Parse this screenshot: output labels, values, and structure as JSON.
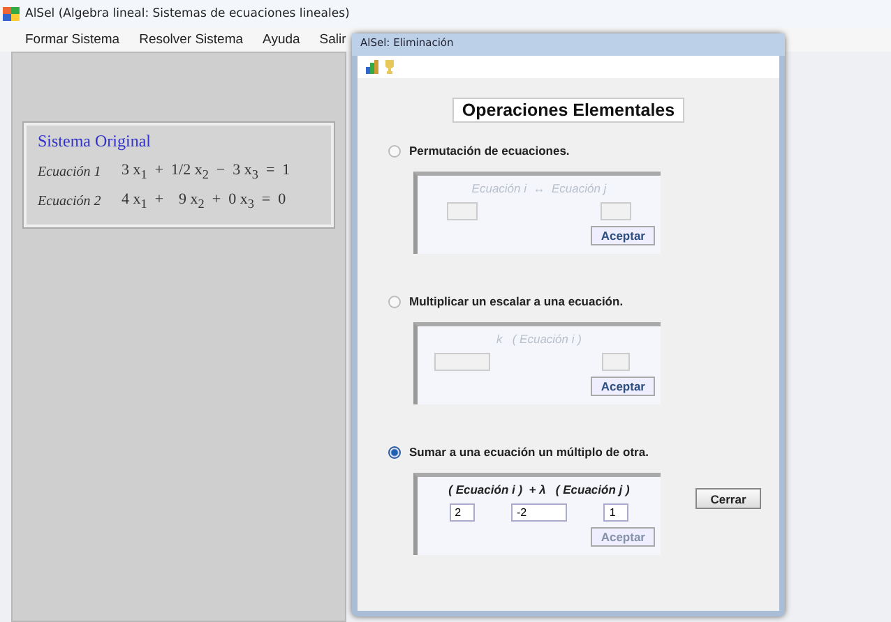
{
  "window": {
    "title": "AlSel (Algebra lineal: Sistemas de ecuaciones lineales)"
  },
  "menu": [
    "Formar Sistema",
    "Resolver Sistema",
    "Ayuda",
    "Salir"
  ],
  "system": {
    "title": "Sistema Original",
    "equations": [
      {
        "label": "Ecuación 1",
        "expression": "3 x$_{1}$  +  1/2 x$_{2}$  −  3 x$_{3}$  =  1"
      },
      {
        "label": "Ecuación 2",
        "expression": "4 x$_{1}$  +    9 x$_{2}$  +  0 x$_{3}$  =  0"
      }
    ]
  },
  "dialog": {
    "title": "AlSel: Eliminación",
    "heading": "Operaciones Elementales",
    "operations": [
      {
        "kind": "permutation",
        "label": "Permutación de ecuaciones.",
        "selected": false,
        "disabled": true,
        "formula": "Ecuación i  ↔  Ecuación j",
        "accept": {
          "label": "Aceptar",
          "disabled": false
        }
      },
      {
        "kind": "scale",
        "label": "Multiplicar un escalar a una ecuación.",
        "selected": false,
        "disabled": true,
        "formula": "k   ( Ecuación i )",
        "accept": {
          "label": "Aceptar",
          "disabled": false
        }
      },
      {
        "kind": "combination",
        "label": "Sumar a una ecuación un múltiplo de otra.",
        "selected": true,
        "disabled": false,
        "formula": "( Ecuación i )  + λ   ( Ecuación j )",
        "fields": [
          {
            "value": "2"
          },
          {
            "value": "-2"
          },
          {
            "value": "1"
          }
        ],
        "accept": {
          "label": "Aceptar",
          "disabled": true
        }
      }
    ],
    "close": "Cerrar"
  }
}
